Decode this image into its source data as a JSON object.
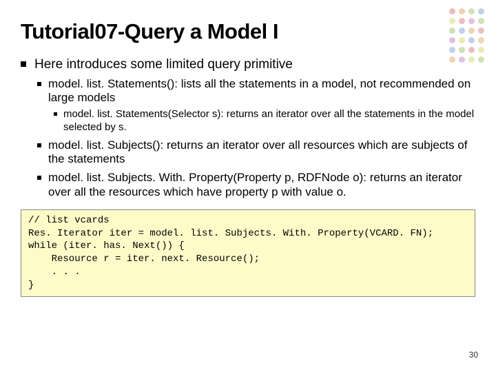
{
  "title": "Tutorial07-Query a Model I",
  "intro": "Here introduces some limited query primitive",
  "b1": "model. list. Statements(): lists all the statements in a model, not recommended on large models",
  "b1a": "model. list. Statements(Selector s): returns an iterator over all the statements in the model selected by s.",
  "b2": "model. list. Subjects(): returns an iterator over all resources which are subjects of the statements",
  "b3": "model. list. Subjects. With. Property(Property p, RDFNode o): returns an iterator over all the resources which have property p with value o.",
  "code": "// list vcards\nRes. Iterator iter = model. list. Subjects. With. Property(VCARD. FN);\nwhile (iter. has. Next()) {\n    Resource r = iter. next. Resource();\n    . . .\n}",
  "page": "30"
}
